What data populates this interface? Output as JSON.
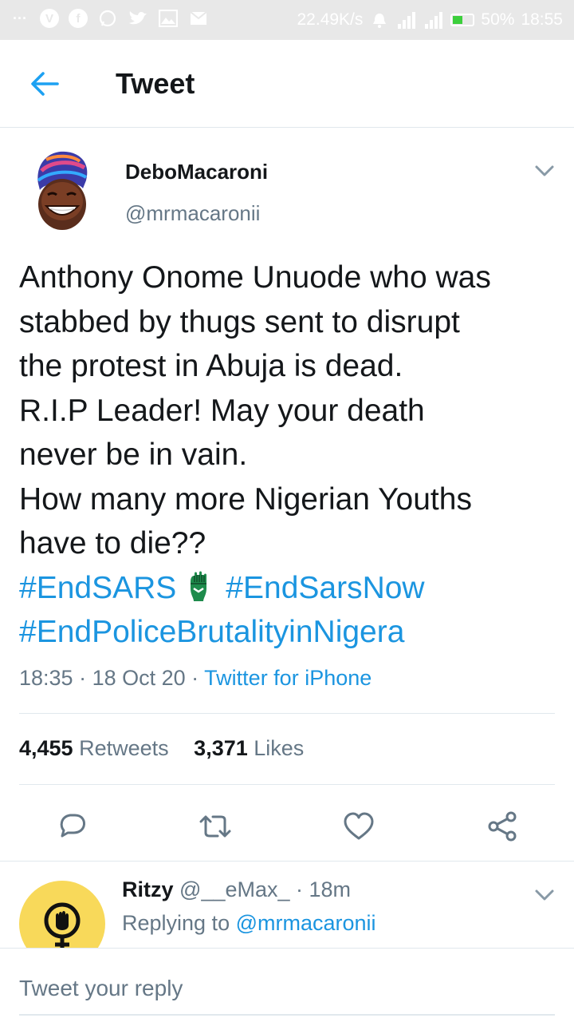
{
  "status_bar": {
    "dots": "···",
    "network_speed": "22.49K/s",
    "battery_percent": "50%",
    "time": "18:55",
    "icons": [
      "vpn-icon",
      "facebook-icon",
      "whatsapp-icon",
      "twitter-icon",
      "gallery-icon",
      "mail-icon",
      "alarm-icon",
      "signal-icon",
      "signal-4g-icon",
      "battery-icon"
    ]
  },
  "header": {
    "title": "Tweet"
  },
  "tweet": {
    "author_name": "DeboMacaroni",
    "author_handle": "@mrmacaronii",
    "body_lines": [
      "Anthony Onome Unuode who was",
      "stabbed by thugs sent to disrupt",
      "the protest in Abuja is dead.",
      "R.I.P Leader! May your death",
      "never be in vain.",
      "How many more Nigerian Youths",
      "have to die??"
    ],
    "hashtags": [
      "#EndSARS",
      "#EndSarsNow",
      "#EndPoliceBrutalityinNigera"
    ],
    "time": "18:35",
    "date": "18 Oct 20",
    "source": "Twitter for iPhone",
    "separator": " · ",
    "retweets_count": "4,455",
    "retweets_label": "Retweets",
    "likes_count": "3,371",
    "likes_label": "Likes"
  },
  "reply": {
    "name": "Ritzy",
    "handle": "@__eMax_",
    "time": "· 18m",
    "replying_prefix": "Replying to",
    "replying_to": "@mrmacaronii"
  },
  "compose": {
    "placeholder": "Tweet your reply"
  },
  "colors": {
    "accent": "#1b95e0",
    "secondary_text": "#657786",
    "primary_text": "#14171a",
    "divider": "#e1e8ed",
    "status_bar_bg": "#e8e8e8",
    "reply_avatar_bg": "#f8d95a"
  }
}
